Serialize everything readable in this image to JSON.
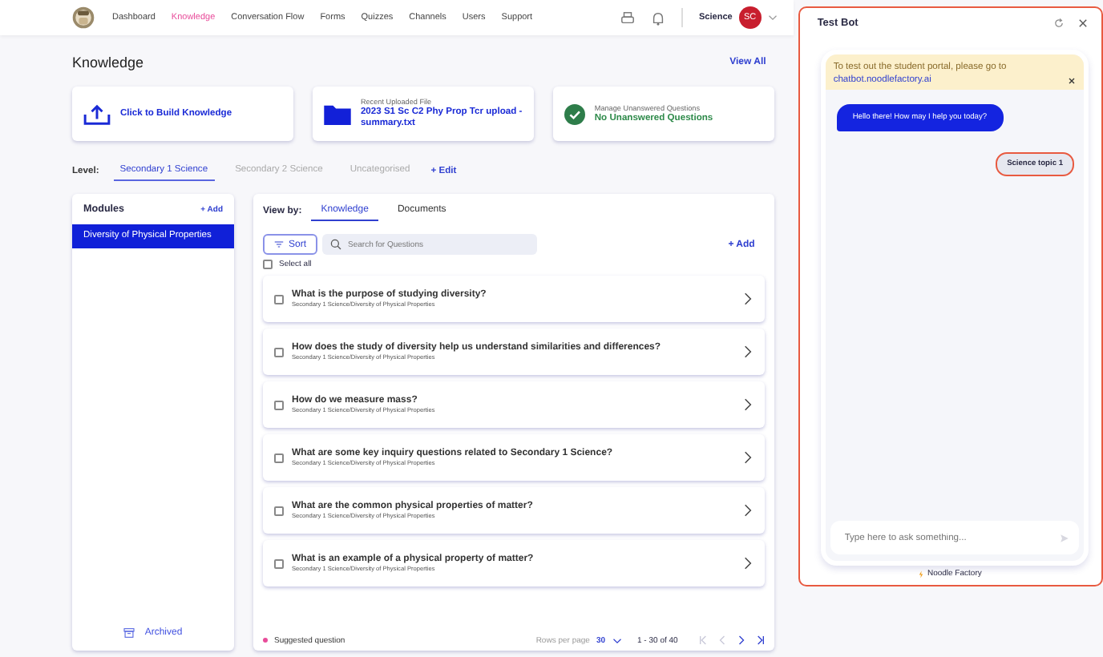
{
  "nav": {
    "items": [
      {
        "label": "Dashboard",
        "selected": false
      },
      {
        "label": "Knowledge",
        "selected": true
      },
      {
        "label": "Conversation Flow",
        "selected": false
      },
      {
        "label": "Forms",
        "selected": false
      },
      {
        "label": "Quizzes",
        "selected": false
      },
      {
        "label": "Channels",
        "selected": false
      },
      {
        "label": "Users",
        "selected": false
      },
      {
        "label": "Support",
        "selected": false
      }
    ],
    "user": "Science",
    "avatar": "SC"
  },
  "page": {
    "title": "Knowledge",
    "view_all": "View All"
  },
  "cards": [
    {
      "kind": "build",
      "value": "Click to Build Knowledge"
    },
    {
      "kind": "file",
      "label": "Recent Uploaded File",
      "value": "2023 S1 Sc C2 Phy Prop Tcr upload - summary.txt"
    },
    {
      "kind": "check",
      "label": "Manage Unanswered Questions",
      "value": "No Unanswered Questions"
    }
  ],
  "level": {
    "label": "Level:",
    "tabs": [
      {
        "label": "Secondary 1 Science",
        "selected": true
      },
      {
        "label": "Secondary 2 Science",
        "selected": false
      },
      {
        "label": "Uncategorised",
        "selected": false
      }
    ],
    "edit": "+ Edit"
  },
  "modules": {
    "title": "Modules",
    "add": "+ Add",
    "items": [
      {
        "label": "Diversity of Physical Properties",
        "selected": true
      }
    ],
    "archived": "Archived"
  },
  "questions": {
    "view_by": "View by:",
    "tabs": [
      {
        "label": "Knowledge",
        "selected": true
      },
      {
        "label": "Documents",
        "selected": false
      }
    ],
    "sort": "Sort",
    "search_placeholder": "Search for Questions",
    "add": "+ Add",
    "select_all": {
      "label": "Select all",
      "checked": false
    },
    "items": [
      {
        "title": "What is the purpose of studying diversity?",
        "path": "Secondary 1 Science/Diversity of Physical Properties",
        "checked": false
      },
      {
        "title": "How does the study of diversity help us understand similarities and differences?",
        "path": "Secondary 1 Science/Diversity of Physical Properties",
        "checked": false
      },
      {
        "title": "How do we measure mass?",
        "path": "Secondary 1 Science/Diversity of Physical Properties",
        "checked": false
      },
      {
        "title": "What are some key inquiry questions related to Secondary 1 Science?",
        "path": "Secondary 1 Science/Diversity of Physical Properties",
        "checked": false
      },
      {
        "title": "What are the common physical properties of matter?",
        "path": "Secondary 1 Science/Diversity of Physical Properties",
        "checked": false
      },
      {
        "title": "What is an example of a physical property of matter?",
        "path": "Secondary 1 Science/Diversity of Physical Properties",
        "checked": false
      }
    ],
    "legend": "Suggested question",
    "rows_label": "Rows per page",
    "rows_value": "30",
    "range": "1 - 30 of 40"
  },
  "test_bot": {
    "title": "Test Bot",
    "notice": "To test out the student portal, please go to",
    "link": "chatbot.noodlefactory.ai",
    "messages": [
      {
        "kind": "bot",
        "text": "Hello there! How may I help you today?"
      },
      {
        "kind": "user",
        "text": "Science topic 1"
      }
    ],
    "input_placeholder": "Type here to ask something...",
    "footer": "Noodle Factory"
  }
}
